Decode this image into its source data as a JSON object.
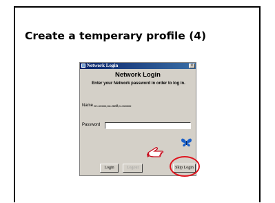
{
  "slide": {
    "title": "Create a temperary profile (4)"
  },
  "dialog": {
    "titlebar": "Network Login",
    "close_glyph": "x",
    "heading": "Network Login",
    "instruction": "Enter your Network password in order to log in.",
    "name_label": "Name",
    "name_value": "cn=xxxxx,ou=staff,o=xxxxxx",
    "password_label": "Password",
    "password_value": "",
    "buttons": {
      "login": "Login",
      "logout": "Logout",
      "skip_login": "Skip Login"
    }
  },
  "annotation": {
    "pointer_icon": "pointing-hand-icon",
    "highlight_color": "#e0141e"
  },
  "colors": {
    "titlebar": "#0a246a",
    "dialog_bg": "#d4d0c8",
    "butterfly": "#1a5fc8"
  }
}
